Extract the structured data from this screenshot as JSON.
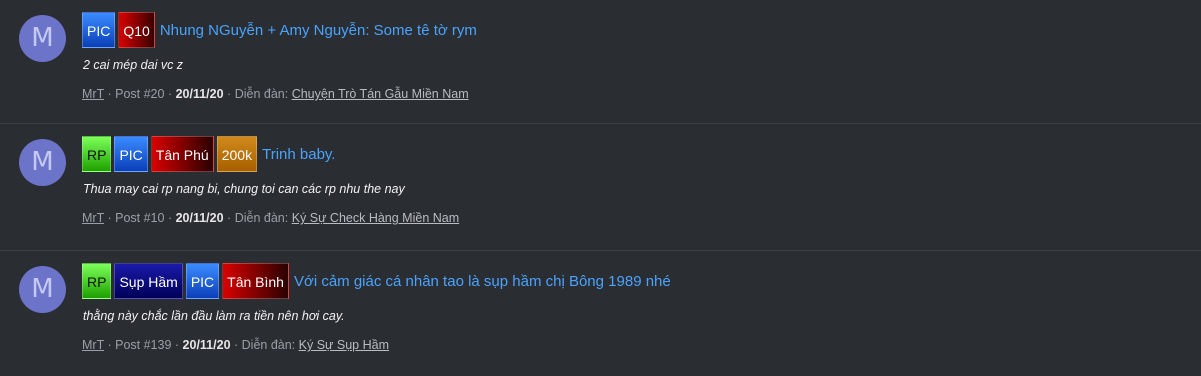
{
  "results": [
    {
      "avatar_letter": "M",
      "badges": [
        {
          "label": "PIC",
          "bg": "linear-gradient(#3b8bff,#0b3fb8)",
          "color": "#ffffff"
        },
        {
          "label": "Q10",
          "bg": "linear-gradient(90deg,#d90000,#3a0000)",
          "color": "#ffffff"
        }
      ],
      "title": "Nhung NGuyễn + Amy Nguyễn: Some tê tờ rym",
      "snippet": "2 cai mép dai vc z",
      "author": "MrT",
      "post": "Post #20",
      "date": "20/11/20",
      "forum_label": "Diễn đàn:",
      "forum": "Chuyện Trò Tán Gẫu Miền Nam"
    },
    {
      "avatar_letter": "M",
      "badges": [
        {
          "label": "RP",
          "bg": "linear-gradient(#7dff5a,#1ea100)",
          "color": "#111111"
        },
        {
          "label": "PIC",
          "bg": "linear-gradient(#3b8bff,#0b3fb8)",
          "color": "#ffffff"
        },
        {
          "label": "Tân Phú",
          "bg": "linear-gradient(90deg,#d90000,#2a0000)",
          "color": "#ffffff"
        },
        {
          "label": "200k",
          "bg": "linear-gradient(#d08a1a,#a85f00)",
          "color": "#ffffff"
        }
      ],
      "title": "Trinh baby.",
      "snippet": "Thua may cai rp nang bi, chung toi can các rp nhu the nay",
      "author": "MrT",
      "post": "Post #10",
      "date": "20/11/20",
      "forum_label": "Diễn đàn:",
      "forum": "Ký Sự Check Hàng Miền Nam"
    },
    {
      "avatar_letter": "M",
      "badges": [
        {
          "label": "RP",
          "bg": "linear-gradient(#7dff5a,#1ea100)",
          "color": "#111111"
        },
        {
          "label": "Sụp Hầm",
          "bg": "linear-gradient(#1a1aa8,#00005a)",
          "color": "#ffffff"
        },
        {
          "label": "PIC",
          "bg": "linear-gradient(#3b8bff,#0b3fb8)",
          "color": "#ffffff"
        },
        {
          "label": "Tân Bình",
          "bg": "linear-gradient(90deg,#d90000,#2a0000)",
          "color": "#ffffff"
        }
      ],
      "title": "Với cảm giác cá nhân tao là sụp hầm chị Bông 1989 nhé",
      "snippet": "thằng này chắc lần đầu làm ra tiền nên hơi cay.",
      "author": "MrT",
      "post": "Post #139",
      "date": "20/11/20",
      "forum_label": "Diễn đàn:",
      "forum": "Ký Sự Sụp Hầm"
    }
  ]
}
